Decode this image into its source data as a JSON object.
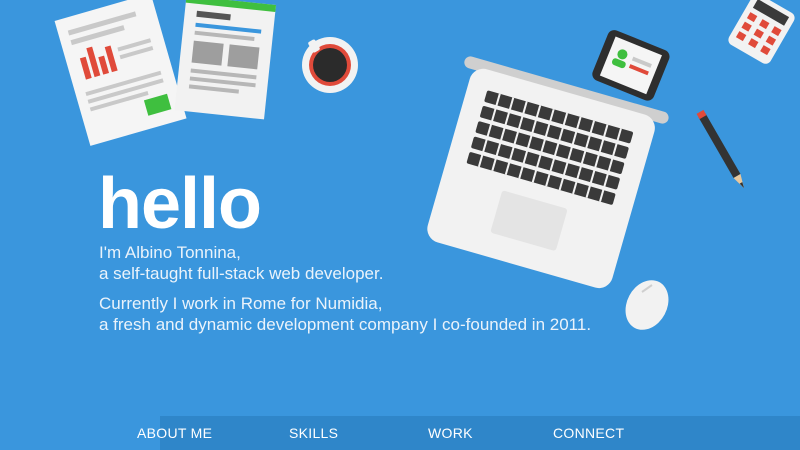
{
  "hero": {
    "title": "hello",
    "intro_line1": "I'm Albino Tonnina,",
    "intro_line2": "a self-taught full-stack web developer.",
    "work_line1": "Currently I work in Rome for Numidia,",
    "work_line2": "a fresh and dynamic development company I co-founded in 2011."
  },
  "nav": {
    "items": [
      "ABOUT ME",
      "SKILLS",
      "WORK",
      "CONNECT"
    ]
  },
  "illustration": {
    "icons": [
      "documents-icon",
      "coffee-cup-icon",
      "laptop-icon",
      "phone-icon",
      "calculator-icon",
      "pencil-icon",
      "mouse-icon"
    ]
  },
  "colors": {
    "background": "#3a96dd",
    "nav_bar": "#2f86c9",
    "text": "#ffffff"
  }
}
